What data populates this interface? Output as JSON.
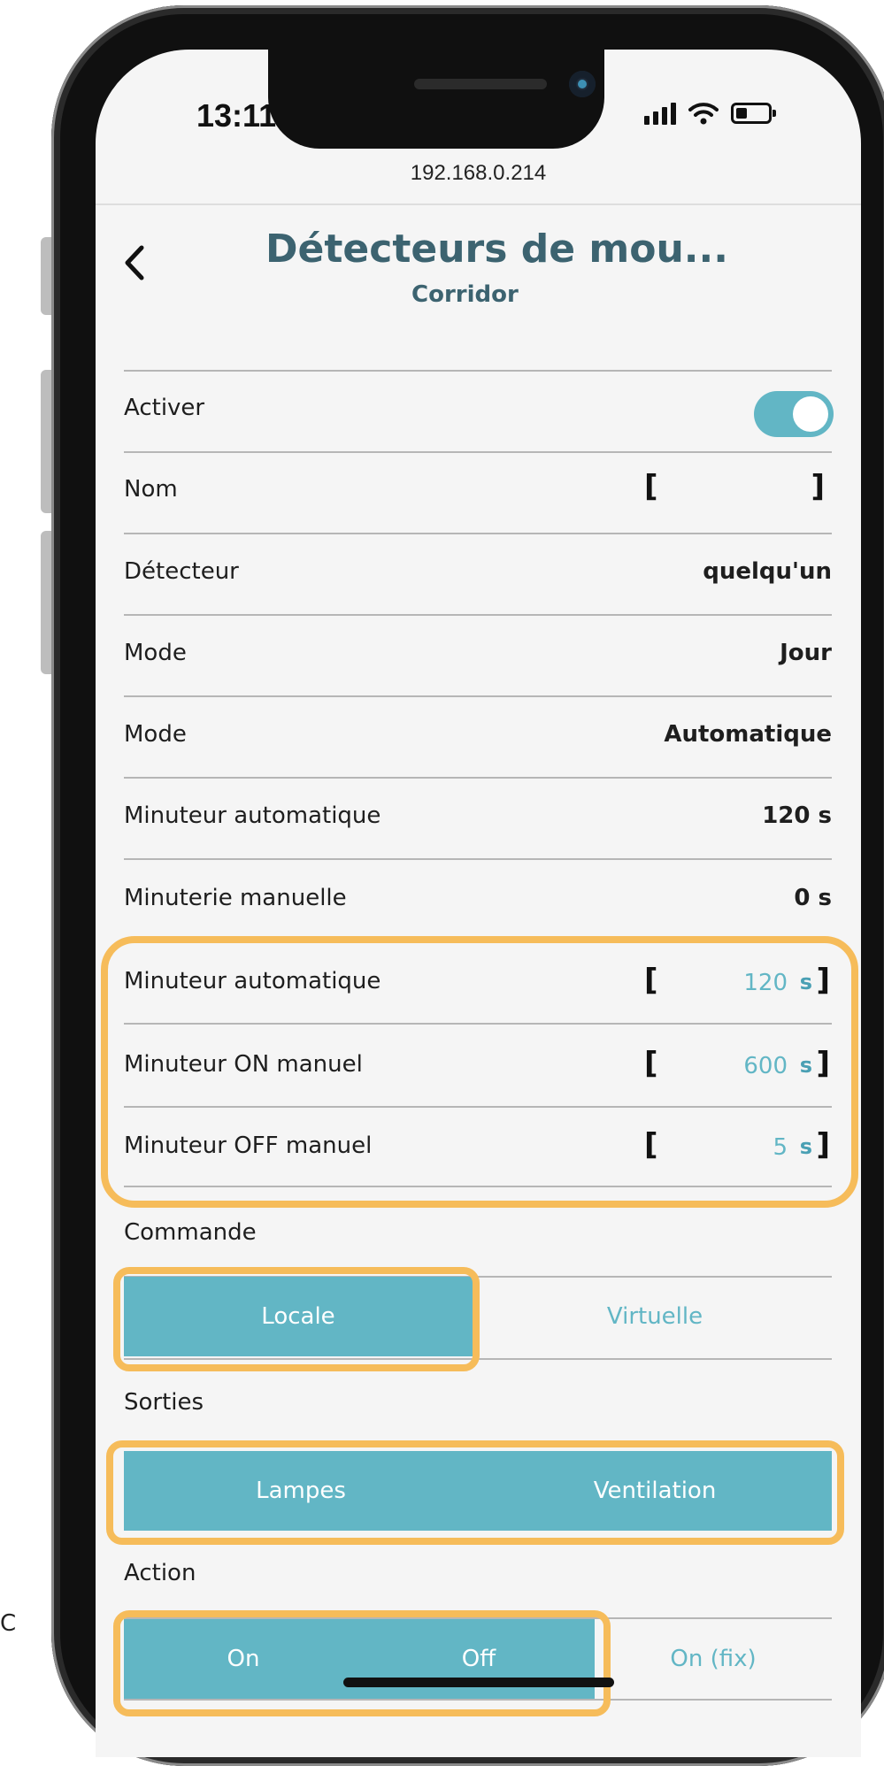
{
  "stray_char": "C",
  "status_bar": {
    "time": "13:11"
  },
  "browser": {
    "url": "192.168.0.214"
  },
  "header": {
    "title": "Détecteurs de mou...",
    "subtitle": "Corridor"
  },
  "settings": {
    "activer": {
      "label": "Activer",
      "enabled": true
    },
    "nom": {
      "label": "Nom",
      "open": "[",
      "close": "]"
    },
    "detecteur": {
      "label": "Détecteur",
      "value": "quelqu'un"
    },
    "mode_1": {
      "label": "Mode",
      "value": "Jour"
    },
    "mode_2": {
      "label": "Mode",
      "value": "Automatique"
    },
    "minuteur_auto": {
      "label": "Minuteur automatique",
      "value": "120 s"
    },
    "minuterie_manuelle": {
      "label": "Minuterie manuelle",
      "value": "0 s"
    }
  },
  "timers": [
    {
      "label": "Minuteur automatique",
      "value": "120",
      "unit": "s"
    },
    {
      "label": "Minuteur ON manuel",
      "value": "600",
      "unit": "s"
    },
    {
      "label": "Minuteur OFF manuel",
      "value": "5",
      "unit": "s"
    }
  ],
  "bracket_open": "[",
  "bracket_close": "]",
  "commande": {
    "label": "Commande",
    "options": [
      "Locale",
      "Virtuelle"
    ],
    "selected": "Locale"
  },
  "sorties": {
    "label": "Sorties",
    "options": [
      "Lampes",
      "Ventilation"
    ],
    "selected": [
      "Lampes",
      "Ventilation"
    ]
  },
  "action": {
    "label": "Action",
    "options": [
      "On",
      "Off",
      "On (fix)"
    ],
    "selected": [
      "On",
      "Off"
    ]
  },
  "colors": {
    "accent": "#62b6c5",
    "title": "#3c6370",
    "highlight": "#f6bc5a"
  }
}
